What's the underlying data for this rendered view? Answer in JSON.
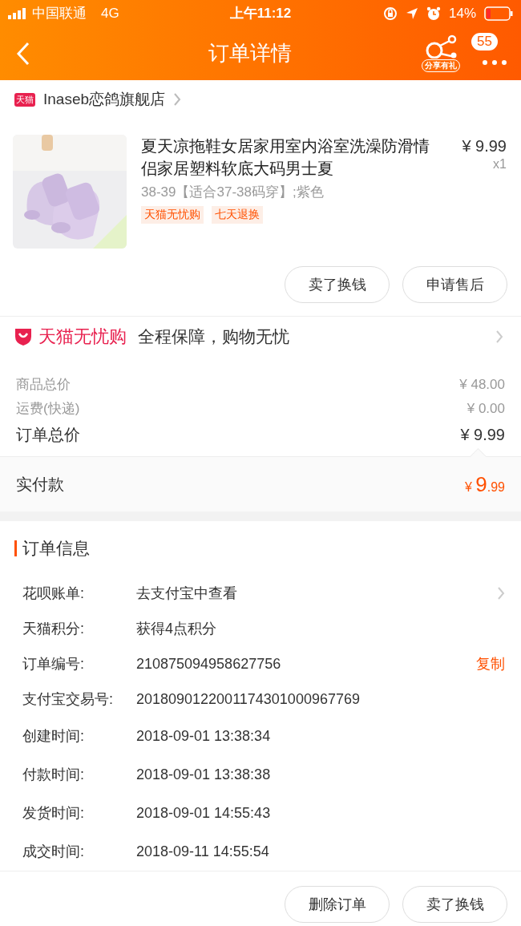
{
  "status_bar": {
    "carrier": "中国联通",
    "network": "4G",
    "time": "上午11:12",
    "battery": "14%"
  },
  "nav": {
    "title": "订单详情",
    "share_label": "分享有礼",
    "badge": "55"
  },
  "shop": {
    "logo": "天猫",
    "name": "Inaseb恋鸽旗舰店"
  },
  "item": {
    "title": "夏天凉拖鞋女居家用室内浴室洗澡防滑情侣家居塑料软底大码男士夏",
    "price": "¥ 9.99",
    "quantity": "x1",
    "sku": "38-39【适合37-38码穿】;紫色",
    "tags": [
      "天猫无忧购",
      "七天退换"
    ],
    "image": {
      "kind": "picture"
    }
  },
  "item_actions": [
    "卖了换钱",
    "申请售后"
  ],
  "guarantee": {
    "brand": "天猫无忧购",
    "text": "全程保障，购物无忧"
  },
  "price_rows": [
    {
      "label": "商品总价",
      "value": "¥ 48.00",
      "kind": "minor"
    },
    {
      "label": "运费(快递)",
      "value": "¥ 0.00",
      "kind": "minor"
    },
    {
      "label": "订单总价",
      "value": "¥ 9.99",
      "kind": "major"
    }
  ],
  "paid": {
    "label": "实付款",
    "currency": "¥",
    "amount": "9",
    "cents": ".99"
  },
  "order_info": {
    "title": "订单信息",
    "rows": [
      {
        "label": "花呗账单:",
        "value": "去支付宝中查看",
        "kind": "link"
      },
      {
        "label": "天猫积分:",
        "value": "获得4点积分",
        "kind": "plain"
      },
      {
        "label": "订单编号:",
        "value": "210875094958627756",
        "kind": "copy",
        "action": "复制"
      },
      {
        "label": "支付宝交易号:",
        "value": "2018090122001174301000967769",
        "kind": "plain"
      },
      {
        "label": "创建时间:",
        "value": "2018-09-01 13:38:34",
        "kind": "plain"
      },
      {
        "label": "付款时间:",
        "value": "2018-09-01 13:38:38",
        "kind": "plain"
      },
      {
        "label": "发货时间:",
        "value": "2018-09-01 14:55:43",
        "kind": "plain"
      },
      {
        "label": "成交时间:",
        "value": "2018-09-11 14:55:54",
        "kind": "plain"
      }
    ]
  },
  "bottom_actions": [
    "删除订单",
    "卖了换钱"
  ]
}
